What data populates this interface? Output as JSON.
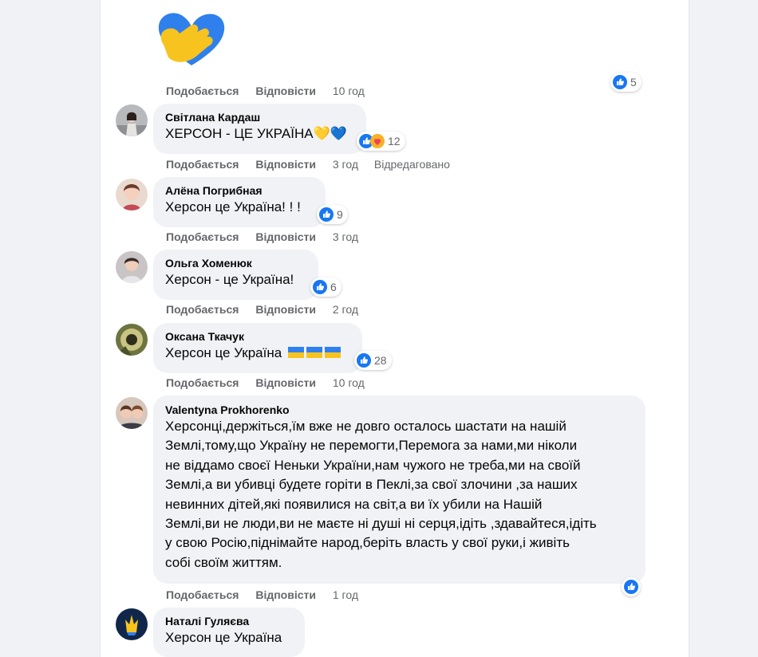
{
  "labels": {
    "like": "Подобається",
    "reply": "Відповісти"
  },
  "top": {
    "time": "10 год",
    "reactions": "5"
  },
  "comments": [
    {
      "author": "Світлана Кардаш",
      "text": "ХЕРСОН - ЦЕ УКРАЇНА",
      "time": "3 год",
      "edited": "Відредаговано",
      "reactions": "12"
    },
    {
      "author": "Алёна Погрибная",
      "text": "Херсон це Україна! ! !",
      "time": "3 год",
      "reactions": "9"
    },
    {
      "author": "Ольга Хоменюк",
      "text": "Херсон - це Україна!",
      "time": "2 год",
      "reactions": "6"
    },
    {
      "author": "Оксана Ткачук",
      "text": "Херсон це Україна",
      "time": "10 год",
      "reactions": "28"
    },
    {
      "author": "Valentyna Prokhorenko",
      "lines": [
        "Херсонці,держіться,їм вже не довго осталось шастати на нашій",
        "Землі,тому,що Україну не перемогти,Перемога за нами,ми ніколи",
        "не віддамо своєї Неньки України,нам чужого не треба,ми на своїй",
        "Землі,а ви убивці будете горіти в Пеклі,за свої злочини ,за наших",
        "невинних дітей,які появилися на світ,а ви їх убили на Нашій",
        "Землі,ви не люди,ви не маєте ні душі ні серця,ідіть ,здавайтеся,ідіть",
        "у свою Росію,піднімайте народ,беріть власть у свої руки,і живіть",
        "собі своїм життям."
      ],
      "time": "1 год"
    },
    {
      "author": "Наталі Гуляєва",
      "text": "Херсон це Україна"
    }
  ],
  "colors": {
    "accent": "#1877f2",
    "bubble": "#f0f2f5",
    "secondary_text": "#65676b"
  },
  "icons": [
    "heart-hug-sticker",
    "like-icon",
    "care-icon",
    "yellow-heart-emoji",
    "blue-heart-emoji",
    "ukraine-flag-emoji"
  ]
}
